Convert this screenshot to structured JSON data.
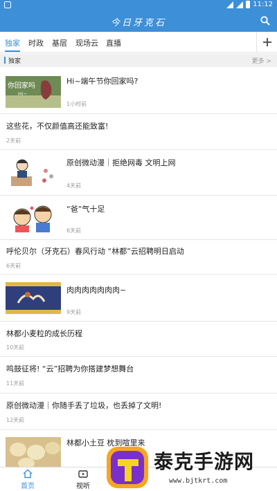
{
  "status": {
    "time": "11:12"
  },
  "app": {
    "title": "今日牙克石"
  },
  "tabs": [
    "独家",
    "时政",
    "基层",
    "现场云",
    "直播"
  ],
  "section": {
    "label": "独家",
    "more": "更多 >"
  },
  "items": [
    {
      "title": "Hi~端午节你回家吗?",
      "meta": "1小时前",
      "thumb_text": "你回家吗",
      "thumb_sub": "Hi~"
    },
    {
      "title": "这些花，不仅颜值高还能致富!",
      "meta": "2天前"
    },
    {
      "title": "原创微动漫｜拒绝网毒 文明上网",
      "meta": "4天前"
    },
    {
      "title": "“爸”气十足",
      "meta": "6天前"
    },
    {
      "title": "呼伦贝尔（牙克石）春风行动 “林都”云招聘明日启动",
      "meta": "6天前"
    },
    {
      "title": "肉肉肉肉肉肉肉~",
      "meta": "9天前"
    },
    {
      "title": "林都小麦粒的成长历程",
      "meta": "10天前"
    },
    {
      "title": "鸣鼓征将! “云”招聘为你搭建梦想舞台",
      "meta": "11天前"
    },
    {
      "title": "原创微动漫｜你随手丢了垃圾，也丢掉了文明!",
      "meta": "12天前"
    },
    {
      "title": "林都小土豆 枕到喧里来",
      "meta": ""
    }
  ],
  "nav": {
    "home": "首页",
    "video": "视听"
  },
  "watermark": {
    "brand": "泰克手游网",
    "url": "www.bjtkrt.com"
  },
  "colors": {
    "accent": "#3d8fd8"
  }
}
